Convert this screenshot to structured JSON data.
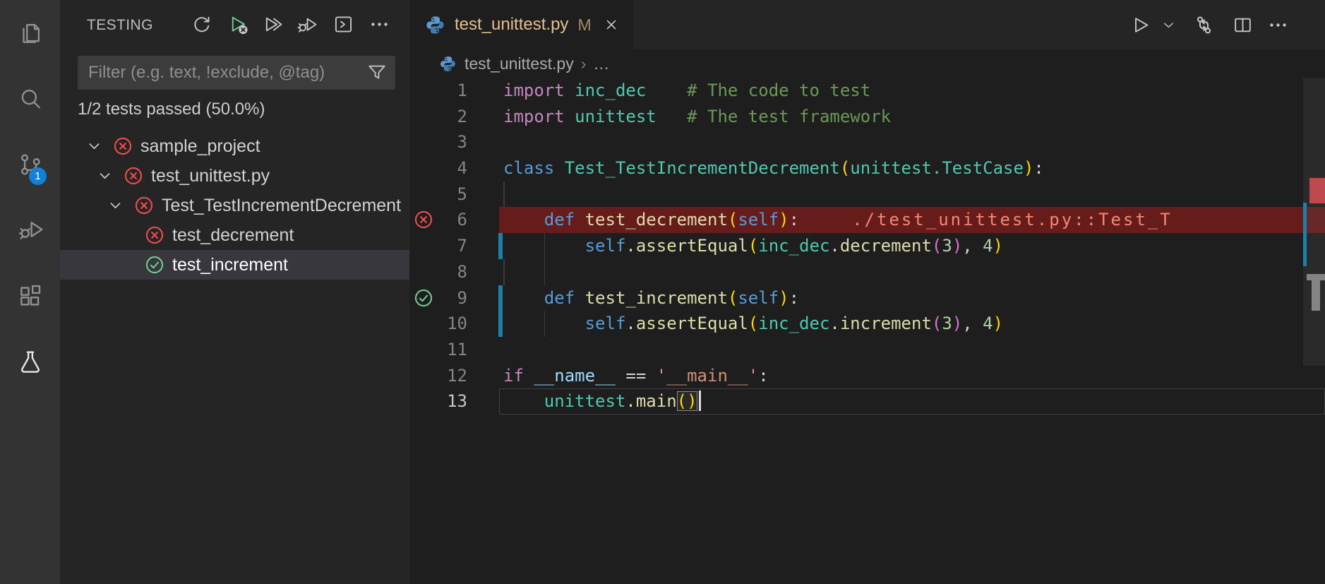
{
  "colors": {
    "error_red": "#f14c4c",
    "pass_green": "#73c991",
    "modified_gutter_blue": "#1b81a8",
    "error_line_background": "#671c1c",
    "error_message_salmon": "#f48771",
    "modified_tab_label": "#e2c08d",
    "activity_badge_blue": "#1081d6"
  },
  "activity_bar": {
    "icons": [
      "explorer-icon",
      "search-icon",
      "source-control-icon",
      "run-and-debug-icon",
      "extensions-icon",
      "testing-icon"
    ],
    "source_control_badge": "1",
    "active_view": "testing"
  },
  "sidebar": {
    "title": "TESTING",
    "toolbar_icons": [
      "refresh-tests-icon",
      "rerun-failed-tests-icon",
      "run-all-tests-icon",
      "debug-tests-icon",
      "show-output-icon",
      "more-actions-icon"
    ],
    "filter": {
      "placeholder": "Filter (e.g. text, !exclude, @tag)"
    },
    "status": "1/2 tests passed (50.0%)",
    "tree": [
      {
        "label": "sample_project",
        "state": "fail",
        "expanded": true,
        "depth": 0
      },
      {
        "label": "test_unittest.py",
        "state": "fail",
        "expanded": true,
        "depth": 1
      },
      {
        "label": "Test_TestIncrementDecrement",
        "state": "fail",
        "expanded": true,
        "depth": 2
      },
      {
        "label": "test_decrement",
        "state": "fail",
        "depth": 3
      },
      {
        "label": "test_increment",
        "state": "pass",
        "depth": 3,
        "selected": true
      }
    ]
  },
  "editor": {
    "tab": {
      "label": "test_unittest.py",
      "modified_badge": "M"
    },
    "actions": [
      "run-file-icon",
      "run-dropdown-chevron-icon",
      "open-changes-icon",
      "split-editor-icon",
      "more-actions-icon"
    ],
    "breadcrumb": {
      "file": "test_unittest.py",
      "separator": "›",
      "more": "…"
    },
    "code": {
      "lines": [
        {
          "n": 1,
          "tokens": [
            [
              "ctrl",
              "import"
            ],
            [
              "txt",
              " "
            ],
            [
              "type",
              "inc_dec"
            ],
            [
              "txt",
              "    "
            ],
            [
              "cmt",
              "# The code to test"
            ]
          ]
        },
        {
          "n": 2,
          "tokens": [
            [
              "ctrl",
              "import"
            ],
            [
              "txt",
              " "
            ],
            [
              "type",
              "unittest"
            ],
            [
              "txt",
              "   "
            ],
            [
              "cmt",
              "# The test framework"
            ]
          ]
        },
        {
          "n": 3,
          "tokens": []
        },
        {
          "n": 4,
          "tokens": [
            [
              "kw",
              "class"
            ],
            [
              "txt",
              " "
            ],
            [
              "type",
              "Test_TestIncrementDecrement"
            ],
            [
              "p1",
              "("
            ],
            [
              "type",
              "unittest.TestCase"
            ],
            [
              "p1",
              ")"
            ],
            [
              "txt",
              ":"
            ]
          ]
        },
        {
          "n": 5,
          "tokens": [],
          "guides": [
            0
          ]
        },
        {
          "n": 6,
          "error": true,
          "test": "fail",
          "tokens": [
            [
              "txt",
              "    "
            ],
            [
              "kw",
              "def"
            ],
            [
              "txt",
              " "
            ],
            [
              "fn",
              "test_decrement"
            ],
            [
              "p1",
              "("
            ],
            [
              "kw",
              "self"
            ],
            [
              "p1",
              ")"
            ],
            [
              "txt",
              ":"
            ]
          ],
          "decoration": "./test_unittest.py::Test_T"
        },
        {
          "n": 7,
          "modified": true,
          "guides": [
            4
          ],
          "tokens": [
            [
              "txt",
              "        "
            ],
            [
              "kw",
              "self"
            ],
            [
              "txt",
              "."
            ],
            [
              "fn",
              "assertEqual"
            ],
            [
              "p1",
              "("
            ],
            [
              "type",
              "inc_dec"
            ],
            [
              "txt",
              "."
            ],
            [
              "fn",
              "decrement"
            ],
            [
              "p2",
              "("
            ],
            [
              "num",
              "3"
            ],
            [
              "p2",
              ")"
            ],
            [
              "txt",
              ", "
            ],
            [
              "num",
              "4"
            ],
            [
              "p1",
              ")"
            ]
          ]
        },
        {
          "n": 8,
          "tokens": [],
          "guides": [
            0,
            4
          ]
        },
        {
          "n": 9,
          "modified": true,
          "test": "pass",
          "tokens": [
            [
              "txt",
              "    "
            ],
            [
              "kw",
              "def"
            ],
            [
              "txt",
              " "
            ],
            [
              "fn",
              "test_increment"
            ],
            [
              "p1",
              "("
            ],
            [
              "kw",
              "self"
            ],
            [
              "p1",
              ")"
            ],
            [
              "txt",
              ":"
            ]
          ]
        },
        {
          "n": 10,
          "modified": true,
          "guides": [
            4
          ],
          "tokens": [
            [
              "txt",
              "        "
            ],
            [
              "kw",
              "self"
            ],
            [
              "txt",
              "."
            ],
            [
              "fn",
              "assertEqual"
            ],
            [
              "p1",
              "("
            ],
            [
              "type",
              "inc_dec"
            ],
            [
              "txt",
              "."
            ],
            [
              "fn",
              "increment"
            ],
            [
              "p2",
              "("
            ],
            [
              "num",
              "3"
            ],
            [
              "p2",
              ")"
            ],
            [
              "txt",
              ", "
            ],
            [
              "num",
              "4"
            ],
            [
              "p1",
              ")"
            ]
          ]
        },
        {
          "n": 11,
          "tokens": []
        },
        {
          "n": 12,
          "tokens": [
            [
              "ctrl",
              "if"
            ],
            [
              "txt",
              " "
            ],
            [
              "var",
              "__name__"
            ],
            [
              "txt",
              " == "
            ],
            [
              "str",
              "'__main__'"
            ],
            [
              "txt",
              ":"
            ]
          ]
        },
        {
          "n": 13,
          "current": true,
          "cursor": true,
          "tokens": [
            [
              "txt",
              "    "
            ],
            [
              "type",
              "unittest"
            ],
            [
              "txt",
              "."
            ],
            [
              "fn",
              "main"
            ],
            [
              "match",
              "()"
            ]
          ]
        }
      ]
    },
    "minimap": {
      "markers": [
        "error-marker",
        "modified-marker",
        "failed-line-highlight"
      ]
    }
  }
}
